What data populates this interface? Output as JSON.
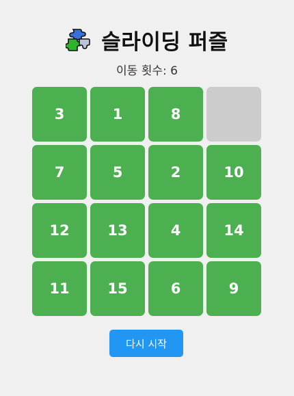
{
  "header": {
    "icon": "puzzle-piece-icon",
    "title": "슬라이딩 퍼즐"
  },
  "status": {
    "moves_label": "이동 횟수: 6"
  },
  "board": {
    "size": 4,
    "tiles": [
      "3",
      "1",
      "8",
      "",
      "7",
      "5",
      "2",
      "10",
      "12",
      "13",
      "4",
      "14",
      "11",
      "15",
      "6",
      "9"
    ]
  },
  "controls": {
    "restart_label": "다시 시작"
  },
  "colors": {
    "tile": "#4caf50",
    "empty_tile": "#cccccc",
    "button": "#2196f3",
    "background": "#f0f0f0"
  }
}
